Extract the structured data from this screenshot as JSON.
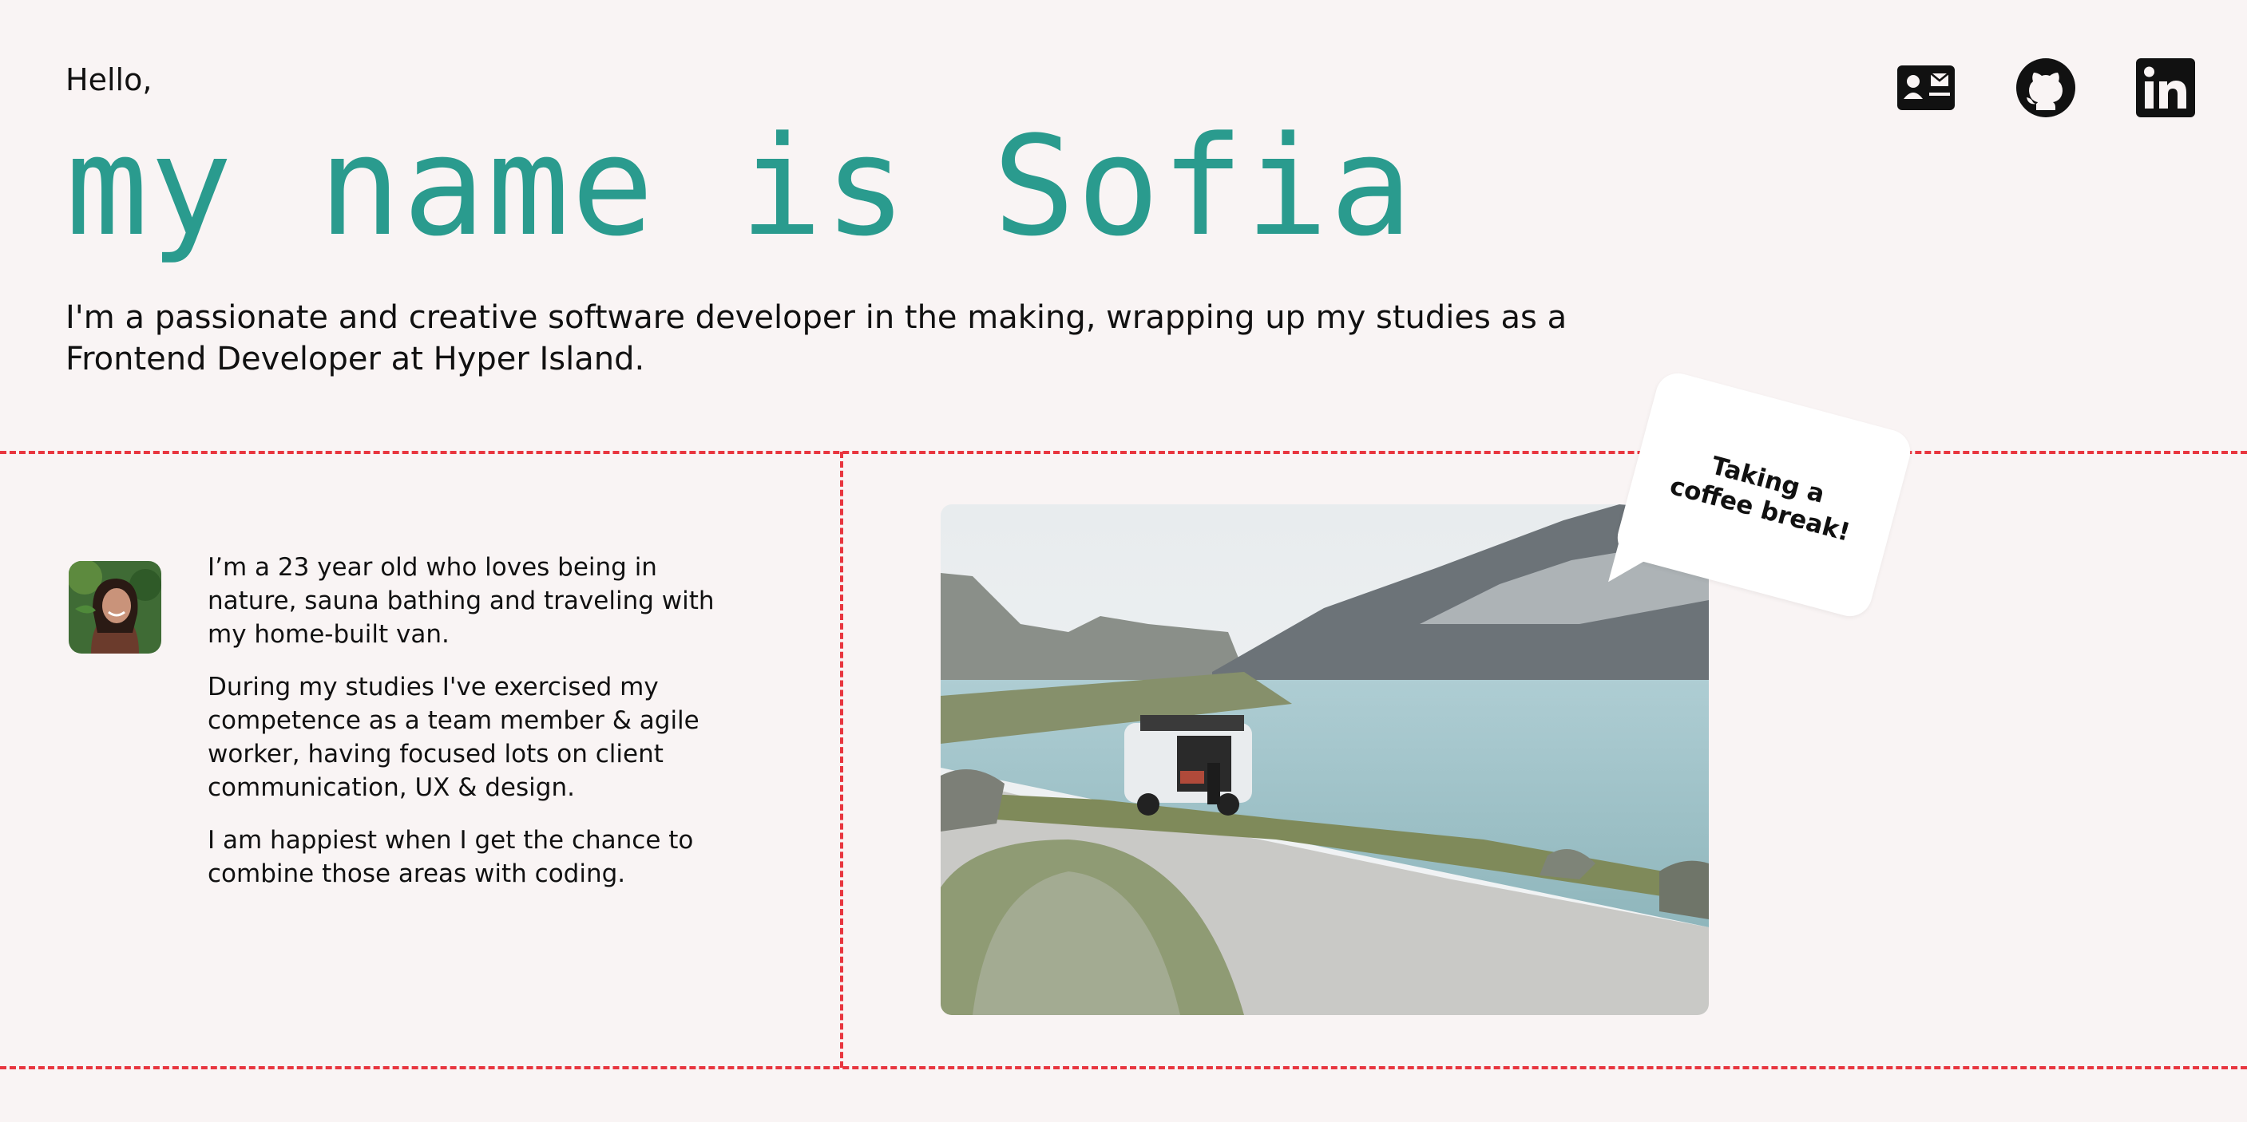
{
  "header": {
    "greeting": "Hello,",
    "title": "my name is Sofia",
    "intro": "I'm a passionate and creative software developer in the making, wrapping up my studies as a Frontend Developer at Hyper Island."
  },
  "socials": [
    {
      "icon": "contact-card-icon"
    },
    {
      "icon": "github-icon"
    },
    {
      "icon": "linkedin-icon"
    }
  ],
  "about": {
    "paragraphs": [
      "I’m a 23 year old who loves being in nature, sauna bathing and traveling with my home-built van.",
      "During my studies I've exercised my competence as a team member & agile worker, having focused lots on client communication, UX & design.",
      "I am happiest when I get the chance to combine those areas with coding."
    ]
  },
  "bubble": {
    "text": "Taking a coffee break!"
  },
  "colors": {
    "background": "#f9f4f4",
    "accent": "#2a9b8e",
    "divider": "#e8363f",
    "text": "#111111"
  }
}
